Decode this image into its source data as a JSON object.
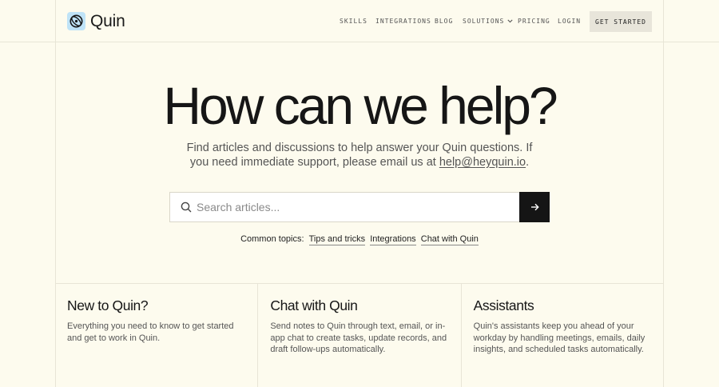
{
  "brand": {
    "name": "Quin",
    "icon": "quin-logo-icon",
    "accent": "#bfe3f7"
  },
  "nav": {
    "items": [
      {
        "label": "SKILLS"
      },
      {
        "label": "INTEGRATIONS"
      },
      {
        "label": "BLOG"
      },
      {
        "label": "SOLUTIONS",
        "icon": "chevron-down-icon"
      },
      {
        "label": "PRICING"
      },
      {
        "label": "LOGIN"
      }
    ],
    "cta": "GET STARTED"
  },
  "hero": {
    "title": "How can we help?",
    "subtitle_pre": "Find articles and discussions to help answer your Quin questions. If you need immediate support, please email us at",
    "email": "help@heyquin.io",
    "subtitle_post": "."
  },
  "search": {
    "placeholder": "Search articles...",
    "value": "",
    "icon": "search-icon",
    "submit_icon": "arrow-right-icon"
  },
  "topics": {
    "label": "Common topics:",
    "items": [
      "Tips and tricks",
      "Integrations",
      "Chat with Quin"
    ]
  },
  "cards": [
    {
      "title": "New to Quin?",
      "description": "Everything you need to know to get started and get to work in Quin."
    },
    {
      "title": "Chat with Quin",
      "description": "Send notes to Quin through text, email, or in-app chat to create tasks, update records, and draft follow-ups automatically."
    },
    {
      "title": "Assistants",
      "description": "Quin's assistants keep you ahead of your workday by handling meetings, emails, daily insights, and scheduled tasks automatically."
    }
  ],
  "colors": {
    "background": "#fdfbee",
    "dark": "#151515",
    "button": "#e8e5da"
  }
}
